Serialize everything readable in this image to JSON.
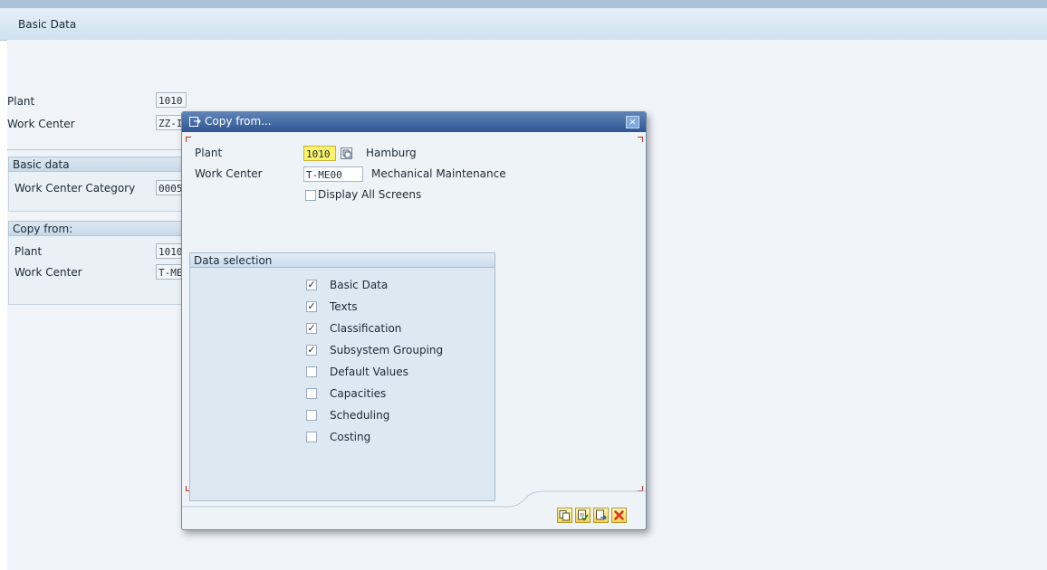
{
  "tab": {
    "label": "Basic Data"
  },
  "background_form": {
    "plant_label": "Plant",
    "plant_value": "1010",
    "work_center_label": "Work Center",
    "work_center_value": "ZZ-I",
    "basic_data_group": {
      "title": "Basic data",
      "category_label": "Work Center Category",
      "category_value": "0005"
    },
    "copy_from_group": {
      "title": "Copy from:",
      "plant_label": "Plant",
      "plant_value": "1010",
      "work_center_label": "Work Center",
      "work_center_value": "T-ME"
    }
  },
  "dialog": {
    "title": "Copy from...",
    "close_label": "×",
    "plant_label": "Plant",
    "plant_value": "1010",
    "plant_desc": "Hamburg",
    "work_center_label": "Work Center",
    "work_center_value": "T-ME00",
    "work_center_desc": "Mechanical Maintenance",
    "display_all_label": "Display All Screens",
    "display_all_checked": false,
    "data_selection": {
      "title": "Data selection",
      "items": [
        {
          "label": "Basic Data",
          "checked": true
        },
        {
          "label": "Texts",
          "checked": true
        },
        {
          "label": "Classification",
          "checked": true
        },
        {
          "label": "Subsystem Grouping",
          "checked": true
        },
        {
          "label": "Default Values",
          "checked": false
        },
        {
          "label": "Capacities",
          "checked": false
        },
        {
          "label": "Scheduling",
          "checked": false
        },
        {
          "label": "Costing",
          "checked": false
        }
      ]
    },
    "buttons": [
      {
        "icon": "copy-icon"
      },
      {
        "icon": "document-check-icon"
      },
      {
        "icon": "document-next-icon"
      },
      {
        "icon": "cancel-icon"
      }
    ]
  },
  "colors": {
    "title_bar": "#2f5694",
    "highlight_field": "#fff36b",
    "cancel_red": "#d8341e"
  }
}
